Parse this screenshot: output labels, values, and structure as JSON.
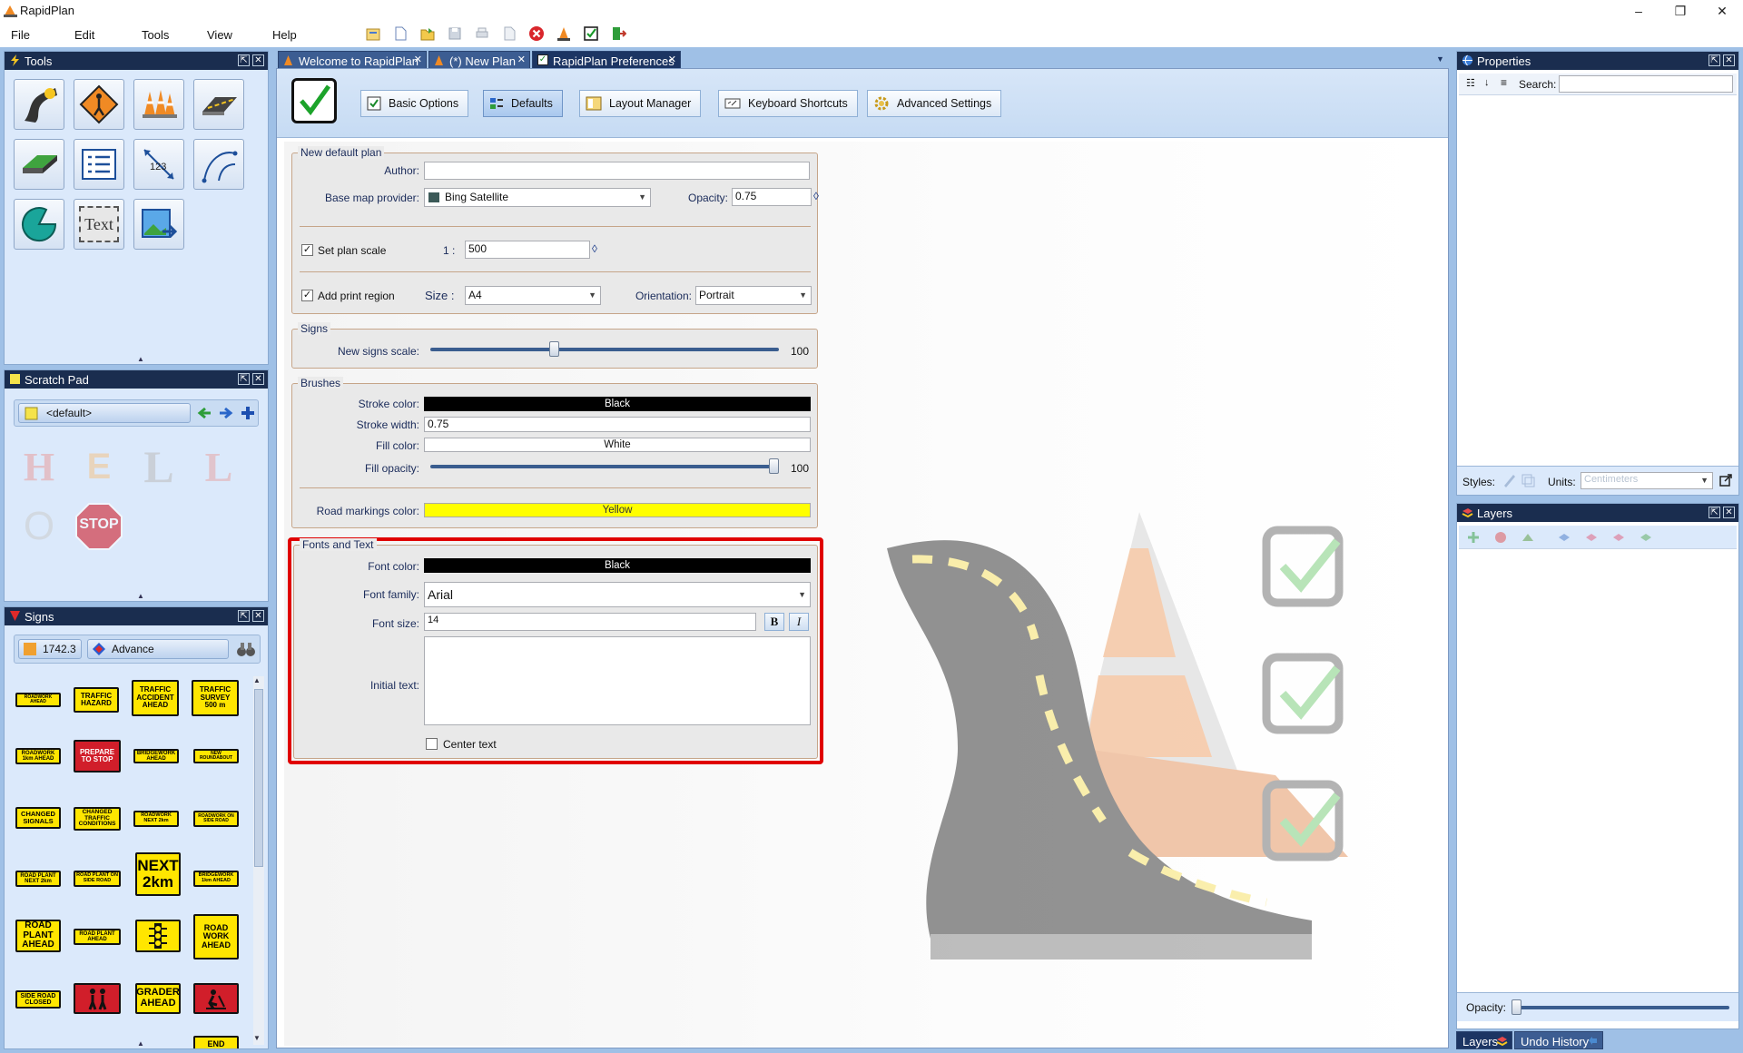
{
  "app": {
    "title": "RapidPlan"
  },
  "window_controls": {
    "minimize": "–",
    "maximize": "❐",
    "close": "✕"
  },
  "menu": [
    "File",
    "Edit",
    "Tools",
    "View",
    "Help"
  ],
  "tools_panel": {
    "title": "Tools",
    "text_tool_label": "Text",
    "measure_label": "123"
  },
  "scratch_pad": {
    "title": "Scratch Pad",
    "dropdown_value": "<default>",
    "letters": [
      "H",
      "E",
      "L",
      "L",
      "O",
      "STOP"
    ]
  },
  "signs_panel": {
    "title": "Signs",
    "code": "1742.3",
    "category": "Advance",
    "signs": [
      [
        "ROADWORK AHEAD",
        "TRAFFIC HAZARD",
        "TRAFFIC ACCIDENT AHEAD",
        "TRAFFIC SURVEY 500 m"
      ],
      [
        "ROADWORK 1km AHEAD",
        "PREPARE TO STOP",
        "BRIDGEWORK AHEAD",
        "NEW ROUNDABOUT"
      ],
      [
        "CHANGED SIGNALS",
        "CHANGED TRAFFIC CONDITIONS",
        "ROADWORK NEXT 2km",
        "ROADWORK ON SIDE ROAD"
      ],
      [
        "ROAD PLANT NEXT 2km",
        "ROAD PLANT ON SIDE ROAD",
        "NEXT 2km",
        "BRIDGEWORK 1km AHEAD"
      ],
      [
        "ROAD PLANT AHEAD",
        "ROAD PLANT AHEAD",
        "",
        "ROAD WORK AHEAD"
      ],
      [
        "SIDE ROAD CLOSED",
        "",
        "GRADER AHEAD",
        ""
      ],
      [
        "",
        "",
        "",
        "END"
      ]
    ]
  },
  "doc_tabs": [
    {
      "label": "Welcome to RapidPlan"
    },
    {
      "label": "(*) New Plan"
    },
    {
      "label": "RapidPlan Preferences"
    }
  ],
  "pref_tabs": [
    "Basic Options",
    "Defaults",
    "Layout Manager",
    "Keyboard Shortcuts",
    "Advanced Settings"
  ],
  "new_default_plan": {
    "title": "New default plan",
    "author_label": "Author:",
    "author_value": "",
    "basemap_label": "Base map provider:",
    "basemap_value": "Bing Satellite",
    "opacity_label": "Opacity:",
    "opacity_value": "0.75",
    "set_scale_label": "Set plan scale",
    "set_scale_checked": "✓",
    "scale_prefix": "1 :",
    "scale_value": "500",
    "print_region_label": "Add print region",
    "print_region_checked": "✓",
    "size_label": "Size :",
    "size_value": "A4",
    "orientation_label": "Orientation:",
    "orientation_value": "Portrait"
  },
  "signs_group": {
    "title": "Signs",
    "scale_label": "New signs scale:",
    "scale_value": "100",
    "scale_level": 0.35
  },
  "brushes": {
    "title": "Brushes",
    "stroke_color_label": "Stroke color:",
    "stroke_color_value": "Black",
    "stroke_width_label": "Stroke width:",
    "stroke_width_value": "0.75",
    "fill_color_label": "Fill color:",
    "fill_color_value": "White",
    "fill_opacity_label": "Fill opacity:",
    "fill_opacity_value": "100",
    "fill_opacity_level": 1.0,
    "road_markings_label": "Road markings color:",
    "road_markings_value": "Yellow"
  },
  "fonts": {
    "title": "Fonts and Text",
    "font_color_label": "Font color:",
    "font_color_value": "Black",
    "font_family_label": "Font family:",
    "font_family_value": "Arial",
    "font_size_label": "Font size:",
    "font_size_value": "14",
    "bold_label": "B",
    "italic_label": "I",
    "initial_text_label": "Initial text:",
    "initial_text_value": "",
    "center_text_label": "Center text"
  },
  "properties": {
    "title": "Properties",
    "search_label": "Search:",
    "search_value": "",
    "styles_label": "Styles:",
    "units_label": "Units:",
    "units_value": "Centimeters"
  },
  "layers": {
    "title": "Layers",
    "opacity_label": "Opacity:"
  },
  "bottom_tabs": [
    "Layers",
    "Undo History"
  ],
  "colors": {
    "highlight": "#e00000",
    "panel_header": "#1a2d4f",
    "frame": "#9fc0e6",
    "road_yellow": "#ffff00"
  }
}
